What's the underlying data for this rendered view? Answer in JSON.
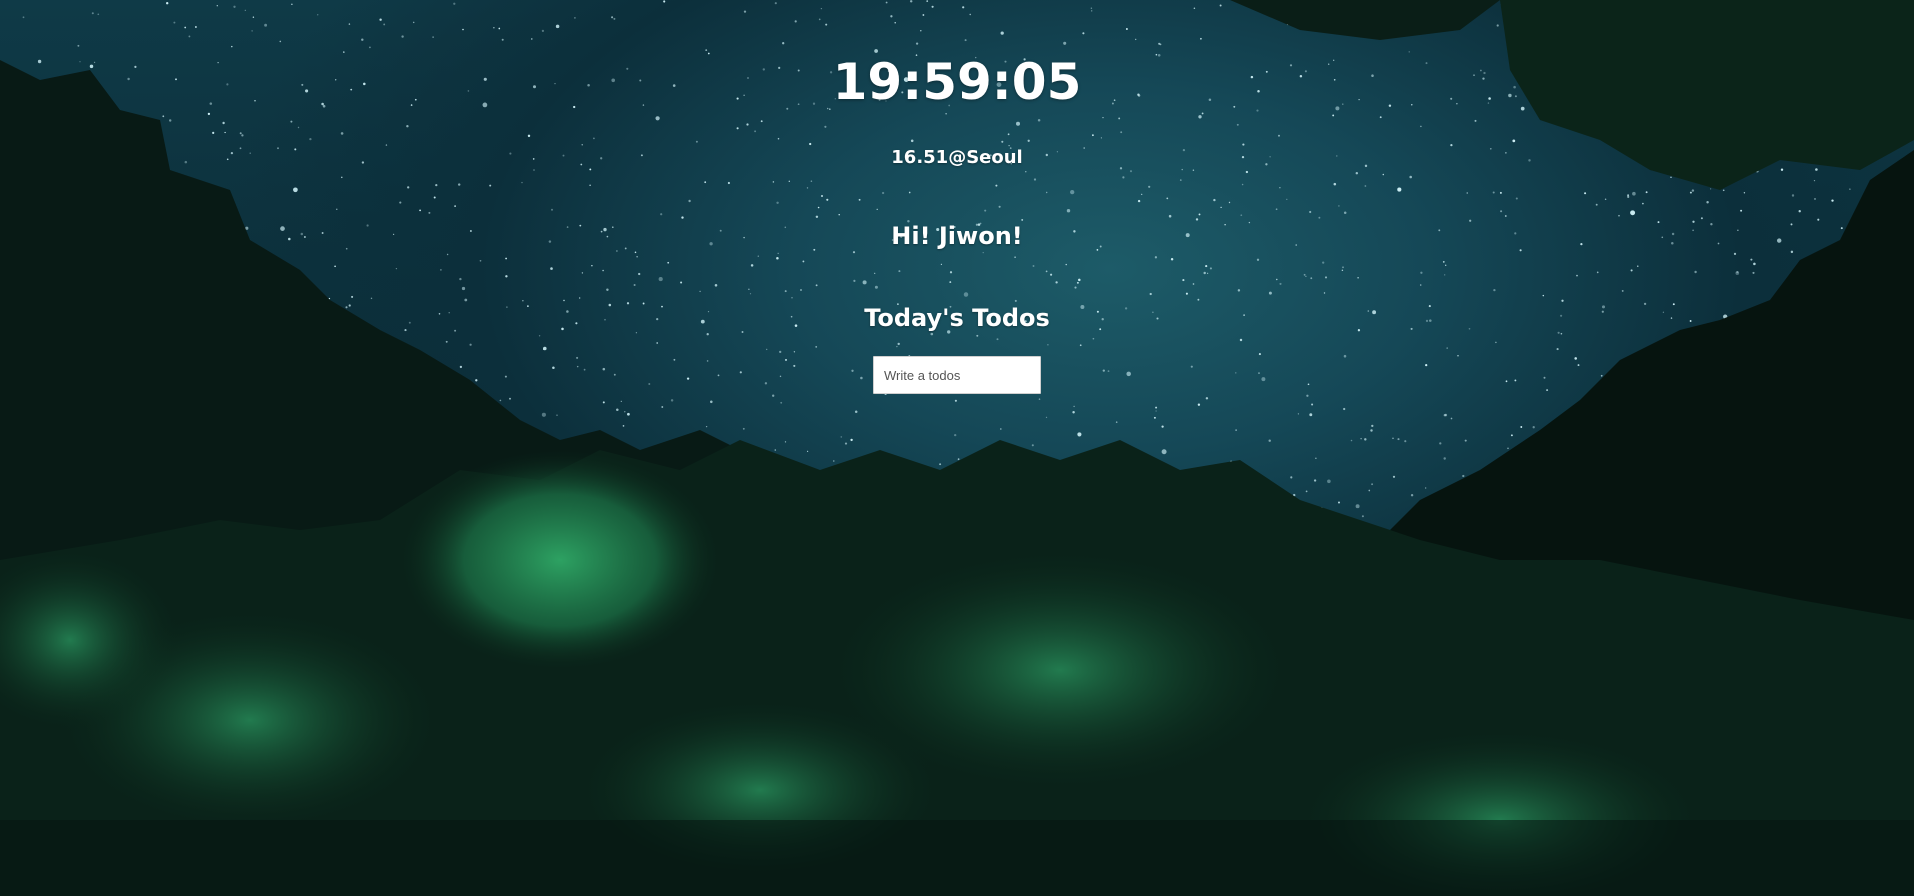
{
  "clock": {
    "time": "19:59:05"
  },
  "weather": {
    "text": "16.51@Seoul"
  },
  "greeting": {
    "text": "Hi! Jiwon!"
  },
  "todos": {
    "title": "Today's Todos",
    "input_placeholder": "Write a todos",
    "input_value": ""
  },
  "background": {
    "sky_color": "#154857",
    "forest_dark": "#06140f",
    "forest_green": "#1f7a4a",
    "star_color": "#cdeff5"
  }
}
